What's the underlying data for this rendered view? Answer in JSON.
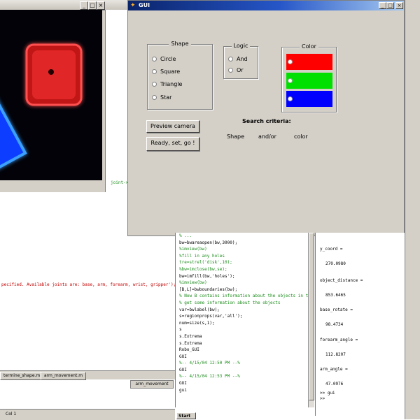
{
  "gui": {
    "title": "GUI",
    "shape_panel": {
      "title": "Shape",
      "options": [
        "Circle",
        "Square",
        "Triangle",
        "Star"
      ]
    },
    "logic_panel": {
      "title": "Logic",
      "options": [
        "And",
        "Or"
      ]
    },
    "color_panel": {
      "title": "Color",
      "swatches": [
        "#ff0000",
        "#00e000",
        "#0000ff"
      ]
    },
    "buttons": {
      "preview": "Preview camera",
      "ready": "Ready, set, go !"
    },
    "search": {
      "heading": "Search criteria:",
      "shape": "Shape",
      "andor": "and/or",
      "color": "color"
    }
  },
  "editor": {
    "lines": [
      {
        "text": "% ...",
        "style": "green"
      },
      {
        "text": "bw=bwareaopen(bw,3000);",
        "style": "black"
      },
      {
        "text": "%imview(bw)",
        "style": "green"
      },
      {
        "text": "%fill in any holes",
        "style": "green"
      },
      {
        "text": "tre=strel('disk',10);",
        "style": "green"
      },
      {
        "text": "%bw=imclose(bw,se);",
        "style": "green"
      },
      {
        "text": "bw=imfill(bw,'holes');",
        "style": "black"
      },
      {
        "text": "%imview(bw)",
        "style": "green"
      },
      {
        "text": "[B,L]=bwboundaries(bw);",
        "style": "black"
      },
      {
        "text": "% Now B contains information about the objects in the",
        "style": "green"
      },
      {
        "text": "% get some information about the objects",
        "style": "green"
      },
      {
        "text": "var=bwlabel(bw);",
        "style": "black"
      },
      {
        "text": "s=regionprops(var,'all');",
        "style": "black"
      },
      {
        "text": "num=size(s,1);",
        "style": "black"
      },
      {
        "text": "s",
        "style": "black"
      },
      {
        "text": "s.Extrema",
        "style": "black"
      },
      {
        "text": "s.Extrema",
        "style": "black"
      },
      {
        "text": "Robo_GUI",
        "style": "black"
      },
      {
        "text": "GUI",
        "style": "black"
      },
      {
        "text": "%-- 4/15/04 12:50 PM --%",
        "style": "green"
      },
      {
        "text": "GUI",
        "style": "black"
      },
      {
        "text": "%-- 4/15/04 12:53 PM --%",
        "style": "green"
      },
      {
        "text": "GUI",
        "style": "black"
      },
      {
        "text": "gui",
        "style": "black"
      }
    ]
  },
  "workspace": {
    "items": [
      {
        "text": "y_coord =",
        "value": "270.0980"
      },
      {
        "text": "object_distance =",
        "value": "853.6465"
      },
      {
        "text": "base_rotate =",
        "value": "98.4734"
      },
      {
        "text": "forearm_angle =",
        "value": "112.8207"
      },
      {
        "text": "arm_angle =",
        "value": "47.0976"
      }
    ],
    "prompt_lines": [
      ">> gui",
      ">>"
    ]
  },
  "console": {
    "error": "pecified. Available joints are: base, arm, forearm, wrist, gripper');",
    "joint": "joint->"
  },
  "tabs": [
    "termine_shape.m",
    "arm_movement.m"
  ],
  "arm_label": "arm_movement",
  "status": {
    "col": "Col 1"
  },
  "start": "Start"
}
